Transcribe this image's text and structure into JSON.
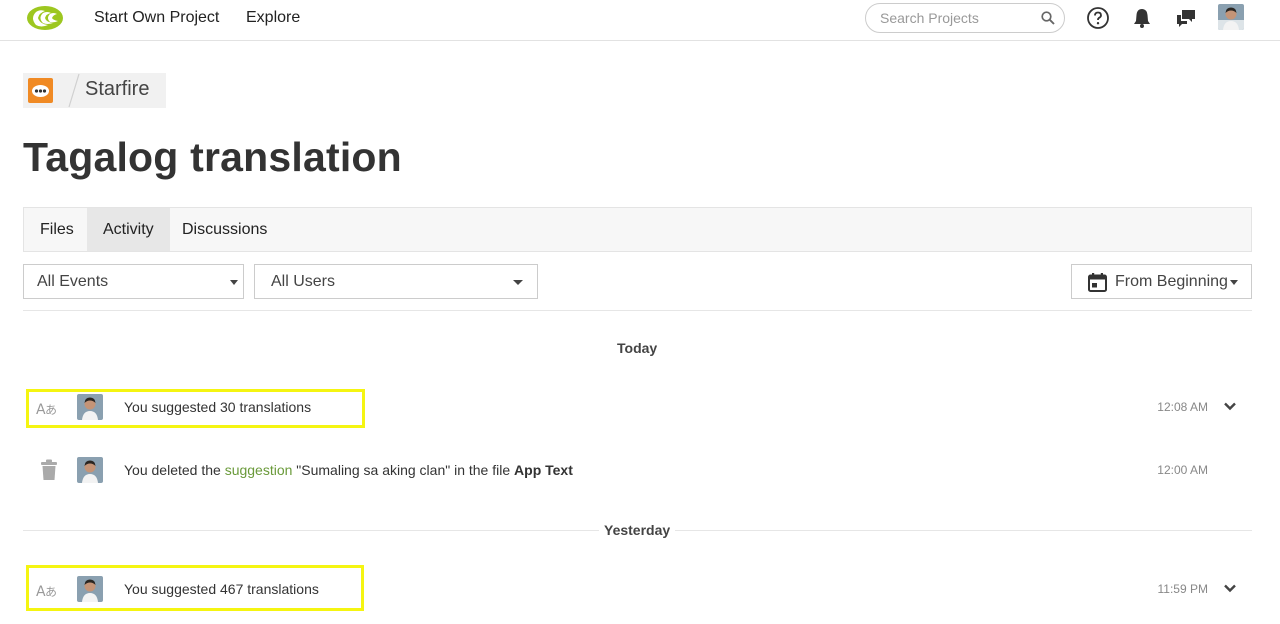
{
  "nav": {
    "start_project": "Start Own Project",
    "explore": "Explore",
    "search_placeholder": "Search Projects"
  },
  "breadcrumb": {
    "project": "Starfire"
  },
  "page_title": "Tagalog translation",
  "tabs": [
    {
      "label": "Files",
      "active": false
    },
    {
      "label": "Activity",
      "active": true
    },
    {
      "label": "Discussions",
      "active": false
    }
  ],
  "filters": {
    "events": "All Events",
    "users": "All Users",
    "date_range": "From Beginning"
  },
  "groups": [
    {
      "day": "Today",
      "items": [
        {
          "icon": "translate-icon",
          "text": "You suggested 30 translations",
          "time": "12:08 AM",
          "highlighted": true,
          "expandable": true
        },
        {
          "icon": "trash-icon",
          "prefix": "You deleted the ",
          "link": "suggestion",
          "middle": " \"Sumaling sa aking clan\" in the file ",
          "bold": "App Text",
          "time": "12:00 AM",
          "highlighted": false,
          "expandable": false
        }
      ]
    },
    {
      "day": "Yesterday",
      "items": [
        {
          "icon": "translate-icon",
          "text": "You suggested 467 translations",
          "time": "11:59 PM",
          "highlighted": true,
          "expandable": true
        }
      ]
    }
  ],
  "colors": {
    "highlight": "#f5f511",
    "link": "#6a9a3a",
    "brand_orange": "#f08a24",
    "logo_green": "#9dc720"
  }
}
